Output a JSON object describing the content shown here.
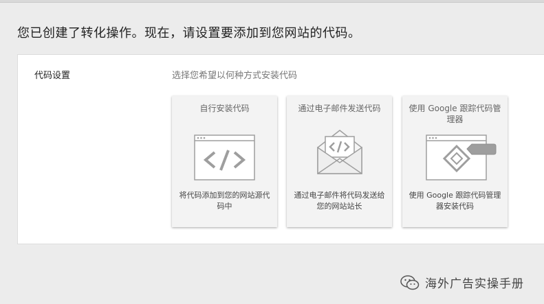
{
  "header": {
    "title": "您已创建了转化操作。现在，请设置要添加到您网站的代码。"
  },
  "setup": {
    "label": "代码设置",
    "hint": "选择您希望以何种方式安装代码",
    "options": [
      {
        "title": "自行安装代码",
        "description": "将代码添加到您的网站源代码中",
        "icon": "browser-code-icon"
      },
      {
        "title": "通过电子邮件发送代码",
        "description": "通过电子邮件将代码发送给您的网站站长",
        "icon": "envelope-code-icon"
      },
      {
        "title": "使用 Google 跟踪代码管理器",
        "description": "使用 Google 跟踪代码管理器安装代码",
        "icon": "tag-manager-icon"
      }
    ]
  },
  "watermark": {
    "text": "海外广告实操手册",
    "icon": "wechat-icon"
  },
  "colors": {
    "background": "#ececec",
    "panel": "#ffffff",
    "card": "#f3f3f3",
    "icon_stroke": "#9e9e9e"
  }
}
